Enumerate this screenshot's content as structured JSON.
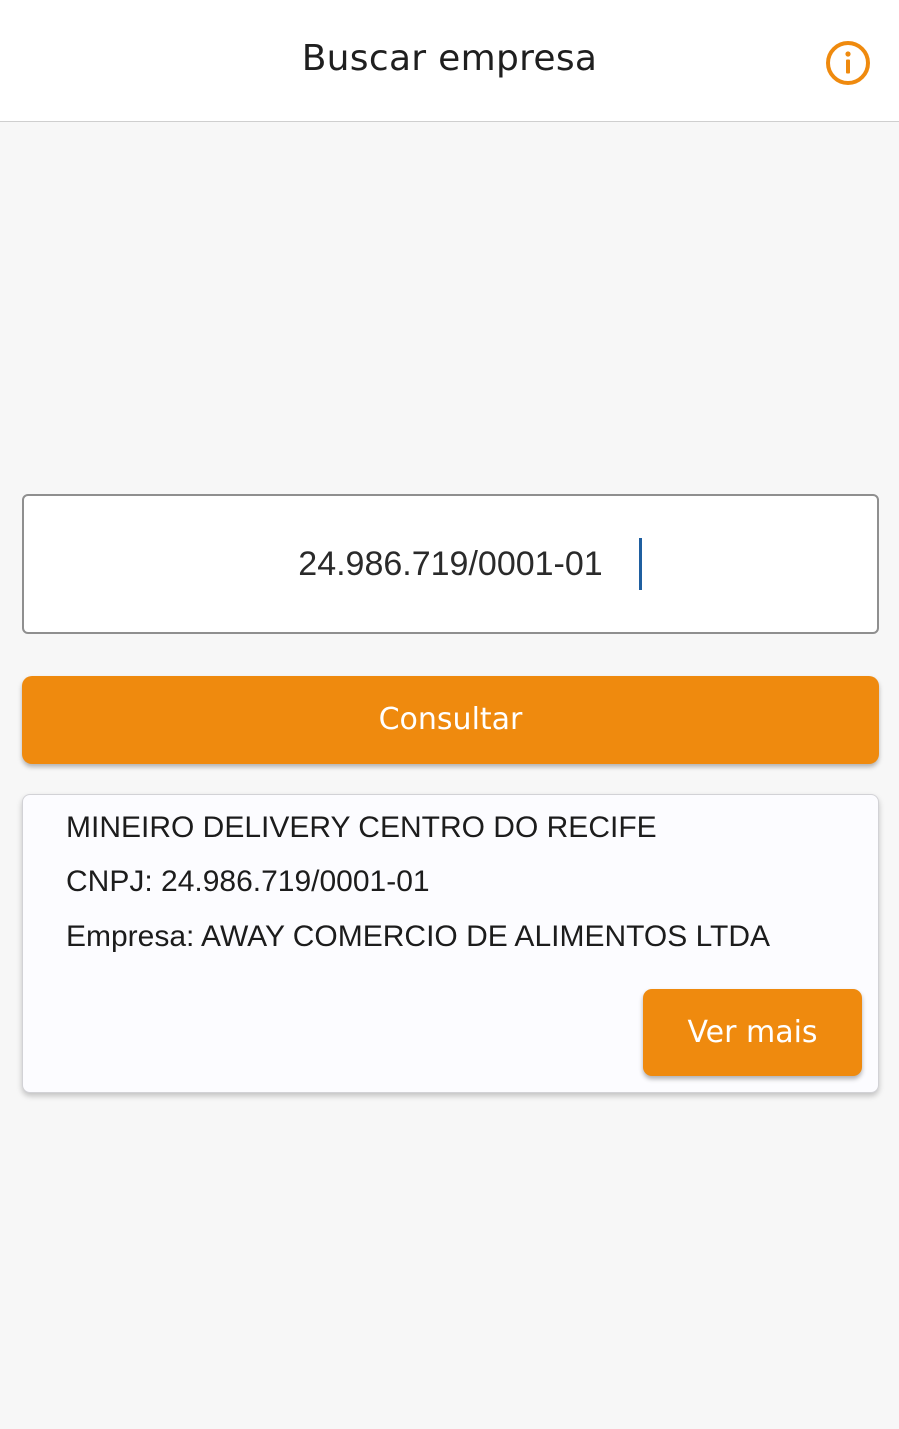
{
  "app_bar": {
    "title": "Buscar empresa",
    "info_icon": "info-circle-icon",
    "accent_color": "#EF8A0E"
  },
  "search": {
    "value": "24.986.719/0001-01"
  },
  "consult_button": {
    "label": "Consultar"
  },
  "result_card": {
    "name": "MINEIRO DELIVERY CENTRO DO RECIFE",
    "cnpj_line": "CNPJ: 24.986.719/0001-01",
    "company_line": "Empresa: AWAY COMERCIO DE ALIMENTOS LTDA",
    "more_button_label": "Ver mais"
  }
}
